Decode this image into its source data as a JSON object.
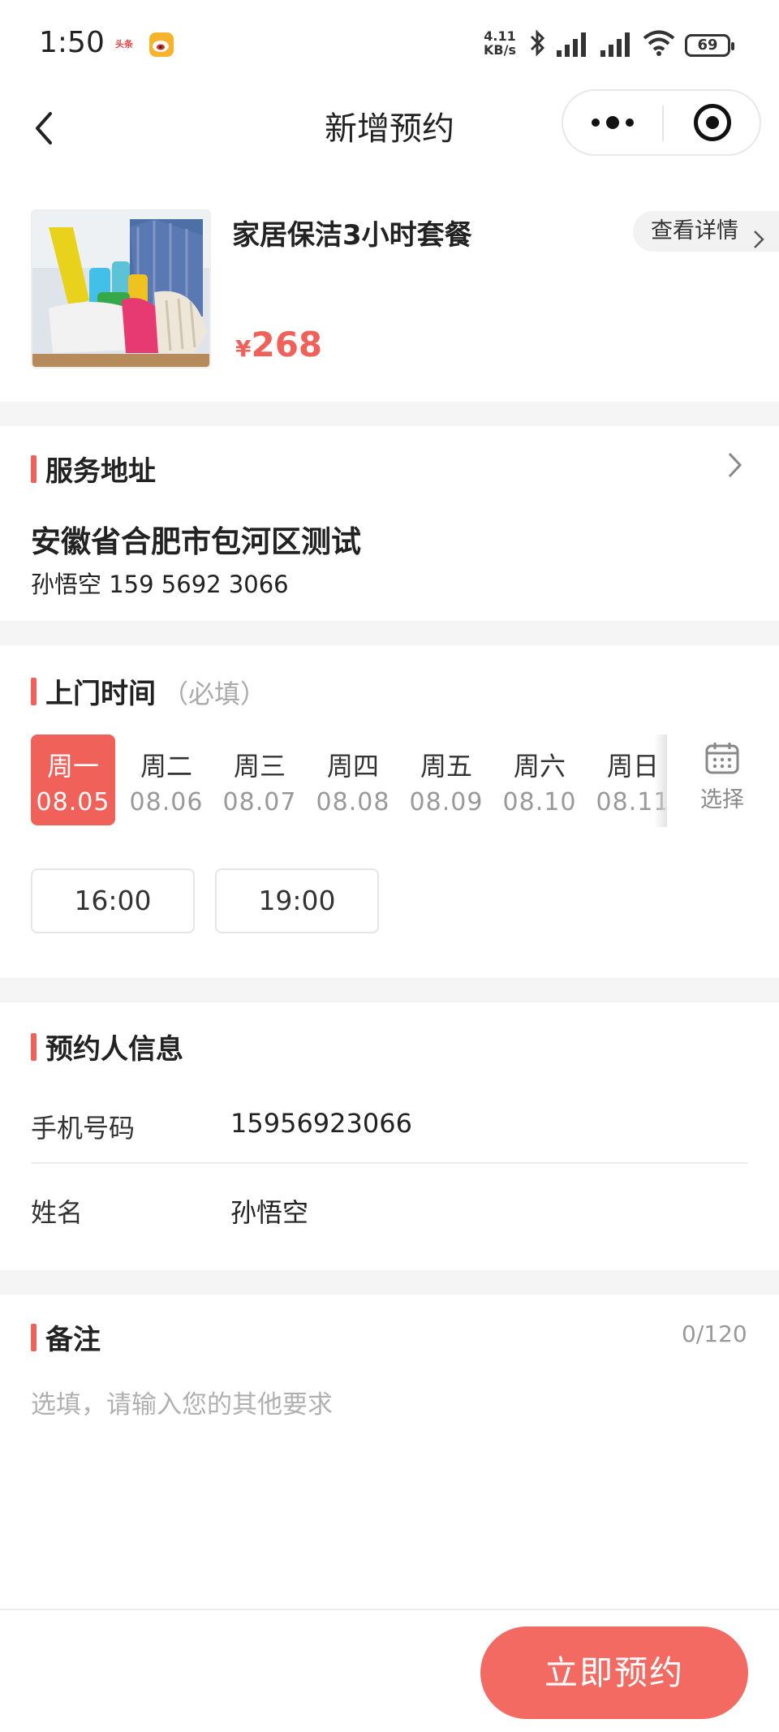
{
  "status_bar": {
    "time": "1:50",
    "app_icons": [
      "头条",
      "微博"
    ],
    "speed_value": "4.11",
    "speed_unit": "KB/s",
    "battery": "69"
  },
  "nav": {
    "title": "新增预约",
    "icons": [
      "back-arrow-icon",
      "more-dots-icon",
      "close-target-icon"
    ]
  },
  "product": {
    "name": "家居保洁3小时套餐",
    "currency": "¥",
    "price": "268",
    "detail_label": "查看详情"
  },
  "address": {
    "title": "服务地址",
    "main": "安徽省合肥市包河区测试",
    "contact": "孙悟空  159 5692 3066"
  },
  "visit_time": {
    "title": "上门时间",
    "hint": "（必填）",
    "dates": [
      {
        "weekday": "周一",
        "date": "08.05",
        "selected": true
      },
      {
        "weekday": "周二",
        "date": "08.06",
        "selected": false
      },
      {
        "weekday": "周三",
        "date": "08.07",
        "selected": false
      },
      {
        "weekday": "周四",
        "date": "08.08",
        "selected": false
      },
      {
        "weekday": "周五",
        "date": "08.09",
        "selected": false
      },
      {
        "weekday": "周六",
        "date": "08.10",
        "selected": false
      },
      {
        "weekday": "周日",
        "date": "08.11",
        "selected": false
      }
    ],
    "calendar_label": "选择",
    "slots": [
      "16:00",
      "19:00"
    ]
  },
  "booker": {
    "title": "预约人信息",
    "phone_label": "手机号码",
    "phone_value": "15956923066",
    "name_label": "姓名",
    "name_value": "孙悟空"
  },
  "remark": {
    "title": "备注",
    "counter": "0/120",
    "placeholder": "选填，请输入您的其他要求"
  },
  "submit_label": "立即预约",
  "colors": {
    "accent": "#f0615a",
    "button": "#f26a62",
    "gap": "#f5f5f5"
  }
}
